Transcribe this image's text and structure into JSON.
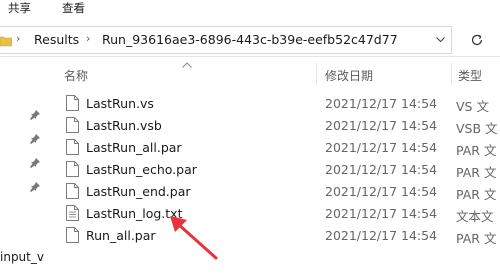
{
  "ribbon": {
    "tabs": [
      "共享",
      "查看"
    ]
  },
  "address_bar": {
    "breadcrumbs": [
      "Results",
      "Run_93616ae3-6896-443c-b39e-eefb52c47d77"
    ],
    "separator": "›",
    "overflow": "«"
  },
  "columns": {
    "name": "名称",
    "modified": "修改日期",
    "type": "类型"
  },
  "files": [
    {
      "name": "LastRun.vs",
      "modified": "2021/12/17 14:54",
      "type": "VS 文",
      "icon": "document-icon"
    },
    {
      "name": "LastRun.vsb",
      "modified": "2021/12/17 14:54",
      "type": "VSB 文",
      "icon": "document-icon"
    },
    {
      "name": "LastRun_all.par",
      "modified": "2021/12/17 14:54",
      "type": "PAR 文",
      "icon": "document-icon"
    },
    {
      "name": "LastRun_echo.par",
      "modified": "2021/12/17 14:54",
      "type": "PAR 文",
      "icon": "document-icon"
    },
    {
      "name": "LastRun_end.par",
      "modified": "2021/12/17 14:54",
      "type": "PAR 文",
      "icon": "document-icon"
    },
    {
      "name": "LastRun_log.txt",
      "modified": "2021/12/17 14:54",
      "type": "文本文",
      "icon": "text-document-icon"
    },
    {
      "name": "Run_all.par",
      "modified": "2021/12/17 14:54",
      "type": "PAR 文",
      "icon": "document-icon"
    }
  ],
  "nav_pane": {
    "truncated_item": "input_v"
  },
  "colors": {
    "annotation_arrow": "#e8323c",
    "sort_arrow": "#8a8a8a"
  }
}
